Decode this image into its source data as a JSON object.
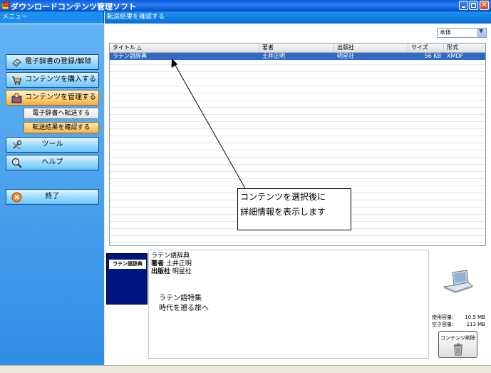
{
  "window": {
    "title": "ダウンロードコンテンツ管理ソフト"
  },
  "sidebar": {
    "header": "メニュー",
    "items": [
      {
        "label": "電子辞書の登録/解除",
        "icon": "dictionary-icon"
      },
      {
        "label": "コンテンツを購入する",
        "icon": "cart-icon"
      },
      {
        "label": "コンテンツを管理する",
        "icon": "manage-icon",
        "active": true
      },
      {
        "label": "ツール",
        "icon": "tools-icon"
      },
      {
        "label": "ヘルプ",
        "icon": "help-icon"
      },
      {
        "label": "終了",
        "icon": "exit-icon"
      }
    ],
    "sub_items": [
      {
        "label": "電子辞書へ転送する"
      },
      {
        "label": "転送結果を確認する",
        "active": true
      }
    ]
  },
  "main": {
    "header": "転送結果を確認する",
    "device_select": {
      "value": "本体"
    },
    "columns": [
      "タイトル △",
      "著者",
      "出版社",
      "サイズ",
      "形式"
    ],
    "rows": [
      {
        "title": "ラテン語辞典",
        "author": "土井正明",
        "publisher": "明星社",
        "size": "56 KB",
        "format": "XMDF",
        "selected": true
      }
    ]
  },
  "annotation": {
    "line1": "コンテンツを選択後に",
    "line2": "詳細情報を表示します"
  },
  "detail": {
    "cover_label": "ラテン語辞典",
    "title": "ラテン語辞典",
    "author_key": "著者",
    "author_value": "土井正明",
    "publisher_key": "出版社",
    "publisher_value": "明星社",
    "desc_line1": "ラテン語特集",
    "desc_line2": "時代を遡る旅へ"
  },
  "capacity": {
    "used_label": "使用容量:",
    "used_value": "10.5 MB",
    "free_label": "空き容量:",
    "free_value": "113 MB"
  },
  "delete_button": {
    "label": "コンテンツ削除"
  },
  "colors": {
    "titlebar": "#0a5fe0",
    "sidebar": "#2f8ee6",
    "active_orange": "#f7a93c",
    "selection": "#316ac5",
    "cover": "#001580"
  }
}
